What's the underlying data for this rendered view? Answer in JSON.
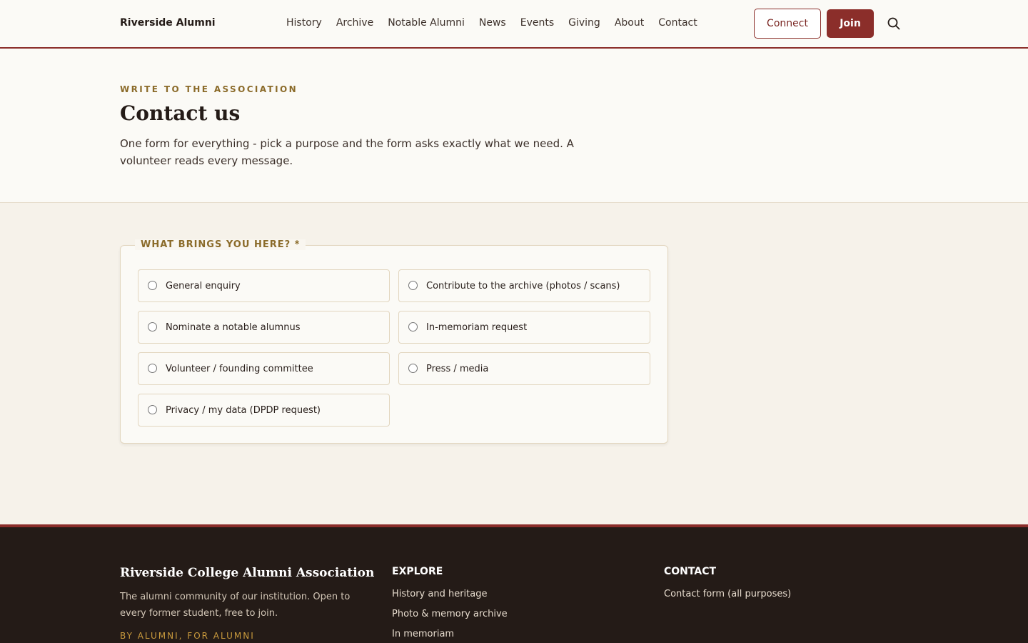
{
  "header": {
    "brand": "Riverside Alumni",
    "nav": [
      "History",
      "Archive",
      "Notable Alumni",
      "News",
      "Events",
      "Giving",
      "About",
      "Contact"
    ],
    "connect_label": "Connect",
    "join_label": "Join"
  },
  "hero": {
    "eyebrow": "WRITE TO THE ASSOCIATION",
    "title": "Contact us",
    "intro": "One form for everything - pick a purpose and the form asks exactly what we need. A volunteer reads every message."
  },
  "form": {
    "legend": "WHAT BRINGS YOU HERE? *",
    "options": [
      "General enquiry",
      "Contribute to the archive (photos / scans)",
      "Nominate a notable alumnus",
      "In-memoriam request",
      "Volunteer / founding committee",
      "Press / media",
      "Privacy / my data (DPDP request)"
    ],
    "selected": null
  },
  "footer": {
    "org_name": "Riverside College Alumni Association",
    "description": "The alumni community of our institution. Open to every former student, free to join.",
    "tagline": "BY ALUMNI, FOR ALUMNI",
    "explore": {
      "heading": "EXPLORE",
      "links": [
        "History and heritage",
        "Photo & memory archive",
        "In memoriam"
      ]
    },
    "contact": {
      "heading": "CONTACT",
      "links": [
        "Contact form (all purposes)"
      ]
    }
  },
  "colors": {
    "accent": "#8b2e2a",
    "gold": "#8b6b2a",
    "footer_bg": "#241b17",
    "page_bg": "#fbfaf6",
    "form_bg": "#f6f2ea"
  },
  "icons": [
    "search-icon"
  ]
}
